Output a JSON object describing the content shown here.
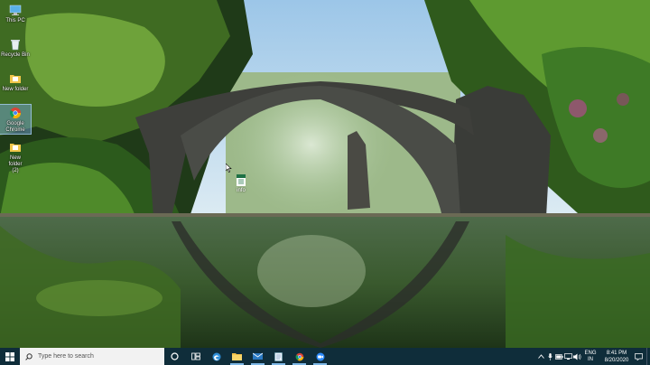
{
  "desktop": {
    "icons": [
      {
        "label": "This PC",
        "icon": "computer-icon"
      },
      {
        "label": "Recycle Bin",
        "icon": "recycle-bin-icon"
      },
      {
        "label": "New folder",
        "icon": "folder-icon"
      },
      {
        "label": "Google Chrome",
        "icon": "chrome-icon"
      },
      {
        "label": "New folder (2)",
        "icon": "folder-icon"
      }
    ],
    "file_label": "info"
  },
  "taskbar": {
    "search_placeholder": "Type here to search",
    "apps": [
      "cortana-icon",
      "task-view-icon",
      "edge-icon",
      "file-explorer-icon",
      "mail-icon",
      "notepad-icon",
      "chrome-icon",
      "zoom-icon"
    ],
    "lang_top": "ENG",
    "lang_bottom": "IN",
    "time": "8:41 PM",
    "date": "8/20/2020"
  },
  "colors": {
    "taskbar": "#0f2d3a",
    "accent": "#7fb8e6"
  }
}
